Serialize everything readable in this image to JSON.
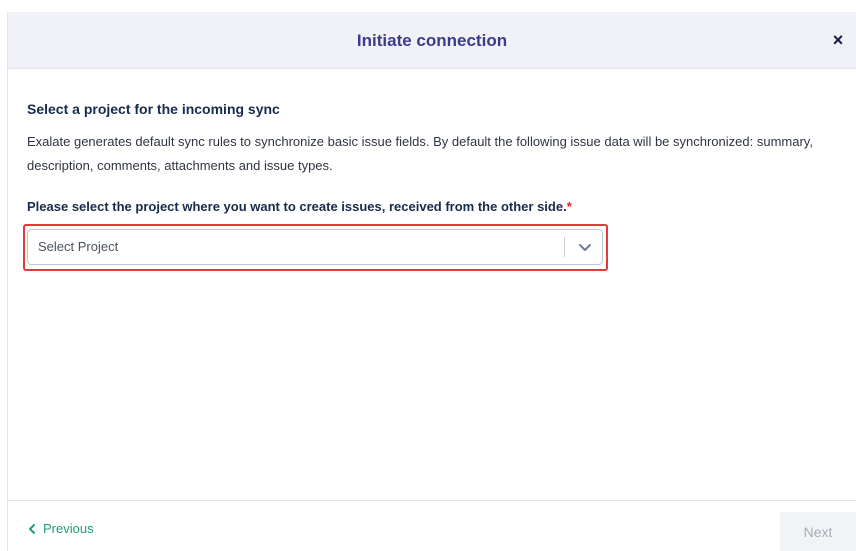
{
  "header": {
    "title": "Initiate connection",
    "close_symbol": "×"
  },
  "main": {
    "section_title": "Select a project for the incoming sync",
    "description": "Exalate generates default sync rules to synchronize basic issue fields. By default the following issue data will be synchronized: summary, description, comments, attachments and issue types.",
    "field_label": "Please select the project where you want to create issues, received from the other side.",
    "required_marker": "*",
    "select": {
      "placeholder": "Select Project",
      "selected_value": ""
    }
  },
  "footer": {
    "previous_label": "Previous",
    "next_label": "Next"
  },
  "colors": {
    "header_bg": "#f1f1f8",
    "title_color": "#3c3b8c",
    "accent_green": "#1f9e6e",
    "highlight_red": "#e53935",
    "disabled_text": "#a5adba"
  },
  "icons": {
    "close": "close-icon",
    "dropdown": "chevron-down-icon",
    "previous": "chevron-left-icon"
  }
}
